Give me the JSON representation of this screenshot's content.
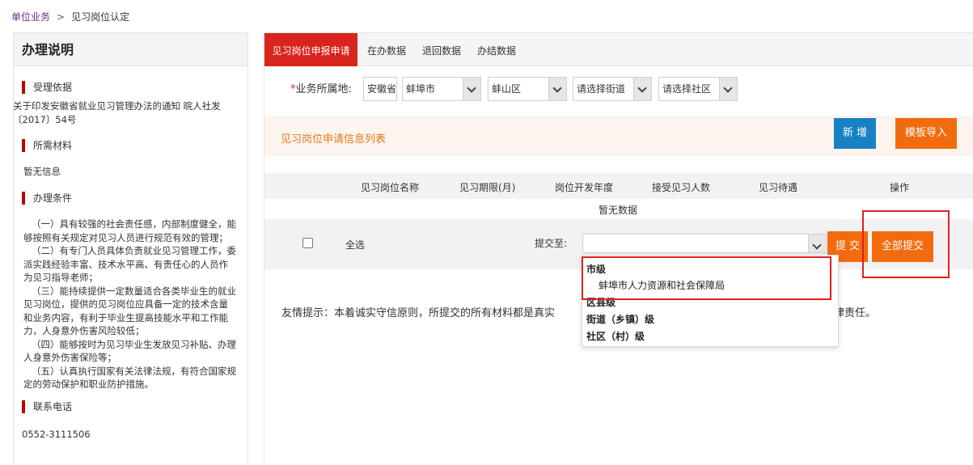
{
  "breadcrumb": {
    "parent": "单位业务",
    "separator": ">",
    "current": "见习岗位认定"
  },
  "sidebar": {
    "title": "办理说明",
    "basis_title": "受理依据",
    "basis_lines": [
      "关于印发安徽省就业见习管理办法的通知 晥人社发",
      "〔2017〕54号"
    ],
    "materials_title": "所需材料",
    "materials_text": "暂无信息",
    "conditions_title": "办理条件",
    "conditions_lines": [
      "（一）具有较强的社会责任感，内部制度健全，能",
      "够按照有关规定对见习人员进行规范有效的管理；",
      "（二）有专门人员具体负责就业见习管理工作，委",
      "派实践经验丰富、技术水平高、有责任心的人员作",
      "为见习指导老师；",
      "（三）能持续提供一定数量适合各类毕业生的就业",
      "见习岗位，提供的见习岗位应具备一定的技术含量",
      "和业务内容，有利于毕业生提高技能水平和工作能",
      "力，人身意外伤害风险较低；",
      "（四）能够按时为见习毕业生发放见习补贴、办理",
      "人身意外伤害保险等；",
      "（五）认真执行国家有关法律法规，有符合国家规",
      "定的劳动保护和职业防护措施。"
    ],
    "phone_title": "联系电话",
    "phone": "0552-3111506"
  },
  "tabs": [
    "见习岗位申报申请",
    "在办数据",
    "退回数据",
    "办结数据"
  ],
  "region": {
    "required_mark": "*",
    "label": "业务所属地:",
    "province": "安徽省",
    "city": "蚌埠市",
    "district": "蚌山区",
    "street_placeholder": "请选择街道",
    "community_placeholder": "请选择社区"
  },
  "list": {
    "title": "见习岗位申请信息列表",
    "add_label": "新 增",
    "import_label": "模板导入"
  },
  "table": {
    "columns": [
      "见习岗位名称",
      "见习期限(月)",
      "岗位开发年度",
      "接受见习人数",
      "见习待遇",
      "操作"
    ],
    "empty_text": "暂无数据"
  },
  "actions": {
    "select_all": "全选",
    "submit_to_label": "提交至:",
    "submit_to_value": "",
    "submit_label": "提 交",
    "submit_all_label": "全部提交"
  },
  "tip": {
    "before": "友情提示：本着诚实守信原则，所提交的所有材料都是真实",
    "after": "法律责任。"
  },
  "dropdown": {
    "city_group": "市级",
    "city_option": "蚌埠市人力资源和社会保障局",
    "county_group": "区县级",
    "street_group": "街道（乡镇）级",
    "community_group": "社区（村）级"
  }
}
